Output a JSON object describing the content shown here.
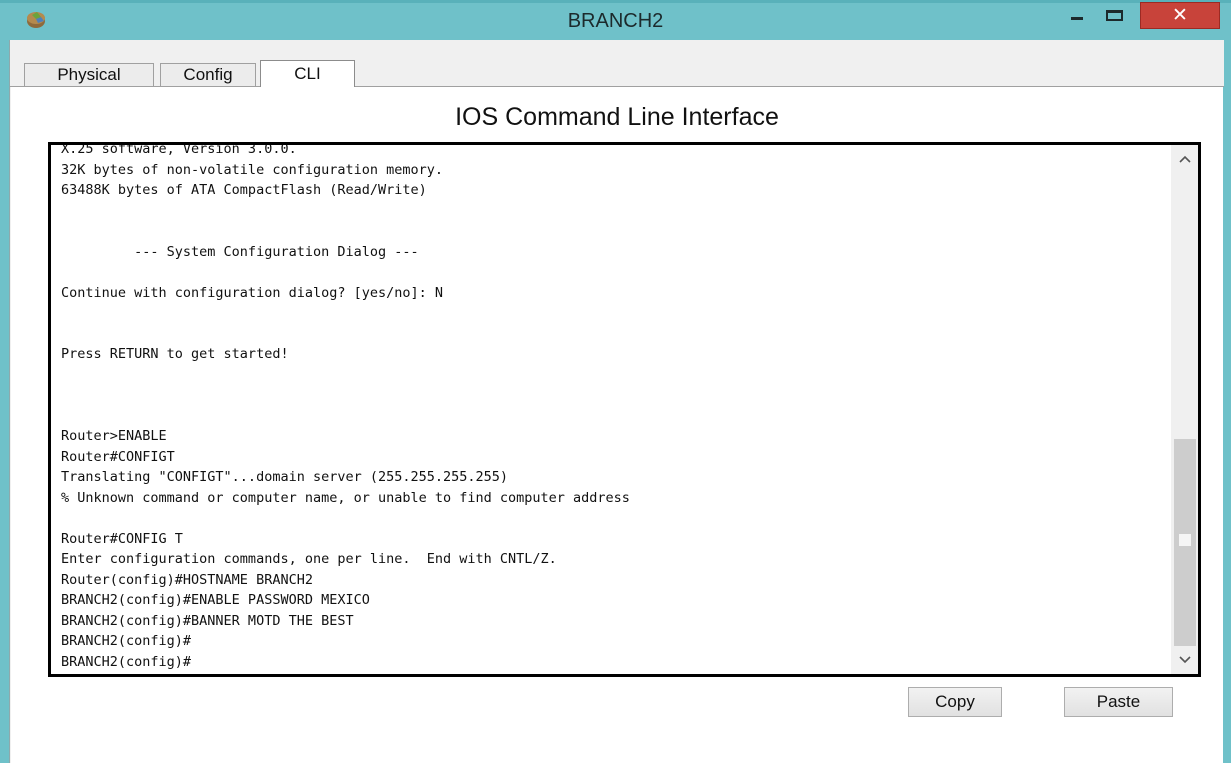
{
  "window": {
    "title": "BRANCH2",
    "controls": {
      "minimize": "minimize-icon",
      "maximize": "maximize-icon",
      "close": "close-icon"
    }
  },
  "tabs": [
    {
      "label": "Physical",
      "active": false
    },
    {
      "label": "Config",
      "active": false
    },
    {
      "label": "CLI",
      "active": true
    }
  ],
  "panel": {
    "title": "IOS Command Line Interface"
  },
  "terminal": {
    "lines": [
      "X.25 software, Version 3.0.0.",
      "32K bytes of non-volatile configuration memory.",
      "63488K bytes of ATA CompactFlash (Read/Write)",
      "",
      "",
      "         --- System Configuration Dialog ---",
      "",
      "Continue with configuration dialog? [yes/no]: N",
      "",
      "",
      "Press RETURN to get started!",
      "",
      "",
      "",
      "Router>ENABLE",
      "Router#CONFIGT",
      "Translating \"CONFIGT\"...domain server (255.255.255.255)",
      "% Unknown command or computer name, or unable to find computer address",
      "",
      "Router#CONFIG T",
      "Enter configuration commands, one per line.  End with CNTL/Z.",
      "Router(config)#HOSTNAME BRANCH2",
      "BRANCH2(config)#ENABLE PASSWORD MEXICO",
      "BRANCH2(config)#BANNER MOTD THE BEST",
      "BRANCH2(config)#",
      "BRANCH2(config)#"
    ]
  },
  "buttons": {
    "copy": "Copy",
    "paste": "Paste"
  },
  "colors": {
    "titlebar": "#6fc1c9",
    "close_button": "#c8433a"
  }
}
